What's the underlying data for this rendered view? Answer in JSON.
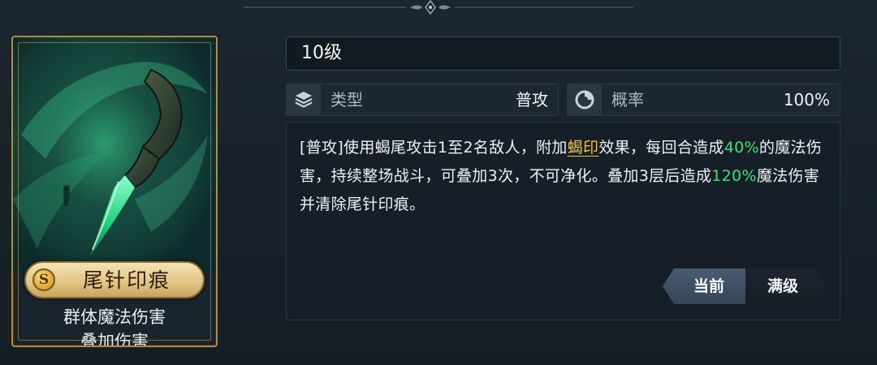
{
  "skill_card": {
    "grade_badge": "S",
    "name": "尾针印痕",
    "tags": [
      "群体魔法伤害",
      "叠加伤害"
    ]
  },
  "skill_info": {
    "level_text": "10级",
    "stats": [
      {
        "icon": "layers-icon",
        "label": "类型",
        "value": "普攻"
      },
      {
        "icon": "chance-pie-icon",
        "label": "概率",
        "value": "100%"
      }
    ],
    "description": {
      "p1": "[普攻]使用蝎尾攻击1至2名敌人，附加",
      "link_keyword": "蝎印",
      "p2": "效果，每回合造成",
      "value1": "40%",
      "p3": "的魔法伤害，持续整场战斗，可叠加3次，不可净化。叠加3层后造成",
      "value2": "120%",
      "p4": "魔法伤害并清除尾针印痕。"
    }
  },
  "level_toggle": {
    "current_label": "当前",
    "max_label": "满级",
    "selected": "current"
  },
  "colors": {
    "background": "#1a232c",
    "gold_frame": "#b58c3e",
    "highlight_green": "#3ee07a",
    "keyword_gold": "#f0c24a",
    "toggle_active": "#4a5c6f"
  }
}
